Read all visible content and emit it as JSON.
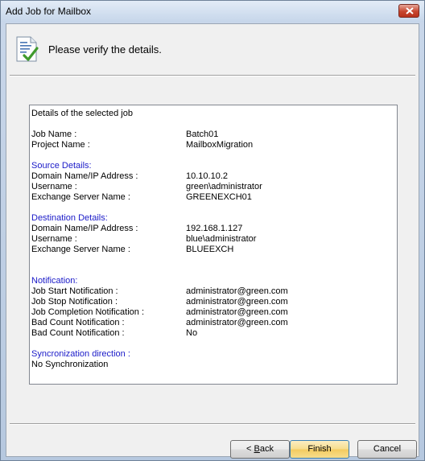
{
  "window": {
    "title": "Add Job for Mailbox"
  },
  "header": {
    "text": "Please verify the details."
  },
  "details": {
    "heading": "Details of the selected job",
    "job_name_label": "Job Name :",
    "job_name_value": "Batch01",
    "project_name_label": "Project Name :",
    "project_name_value": "MailboxMigration",
    "source_heading": "Source Details:",
    "source_domain_label": "Domain Name/IP Address :",
    "source_domain_value": "10.10.10.2",
    "source_username_label": "Username :",
    "source_username_value": "green\\administrator",
    "source_server_label": "Exchange Server Name :",
    "source_server_value": "GREENEXCH01",
    "dest_heading": "Destination Details:",
    "dest_domain_label": "Domain Name/IP Address :",
    "dest_domain_value": "192.168.1.127",
    "dest_username_label": "Username :",
    "dest_username_value": "blue\\administrator",
    "dest_server_label": "Exchange Server Name :",
    "dest_server_value": "BLUEEXCH",
    "notification_heading": "Notification:",
    "job_start_label": "Job Start Notification :",
    "job_start_value": "administrator@green.com",
    "job_stop_label": "Job Stop Notification :",
    "job_stop_value": "administrator@green.com",
    "job_completion_label": "Job Completion Notification :",
    "job_completion_value": "administrator@green.com",
    "bad_count_label_1": "Bad Count Notification :",
    "bad_count_value_1": "administrator@green.com",
    "bad_count_label_2": "Bad Count Notification :",
    "bad_count_value_2": "No",
    "sync_heading": "Syncronization direction :",
    "sync_value": "No Synchronization"
  },
  "buttons": {
    "back_prefix": "< ",
    "back_mnemonic": "B",
    "back_rest": "ack",
    "finish": "Finish",
    "cancel": "Cancel"
  },
  "icons": {
    "header": "document-check-icon",
    "close": "close-icon"
  },
  "colors": {
    "section_heading": "#1a1ac8",
    "close_button": "#c7452e",
    "finish_button": "#f7dd8c"
  }
}
